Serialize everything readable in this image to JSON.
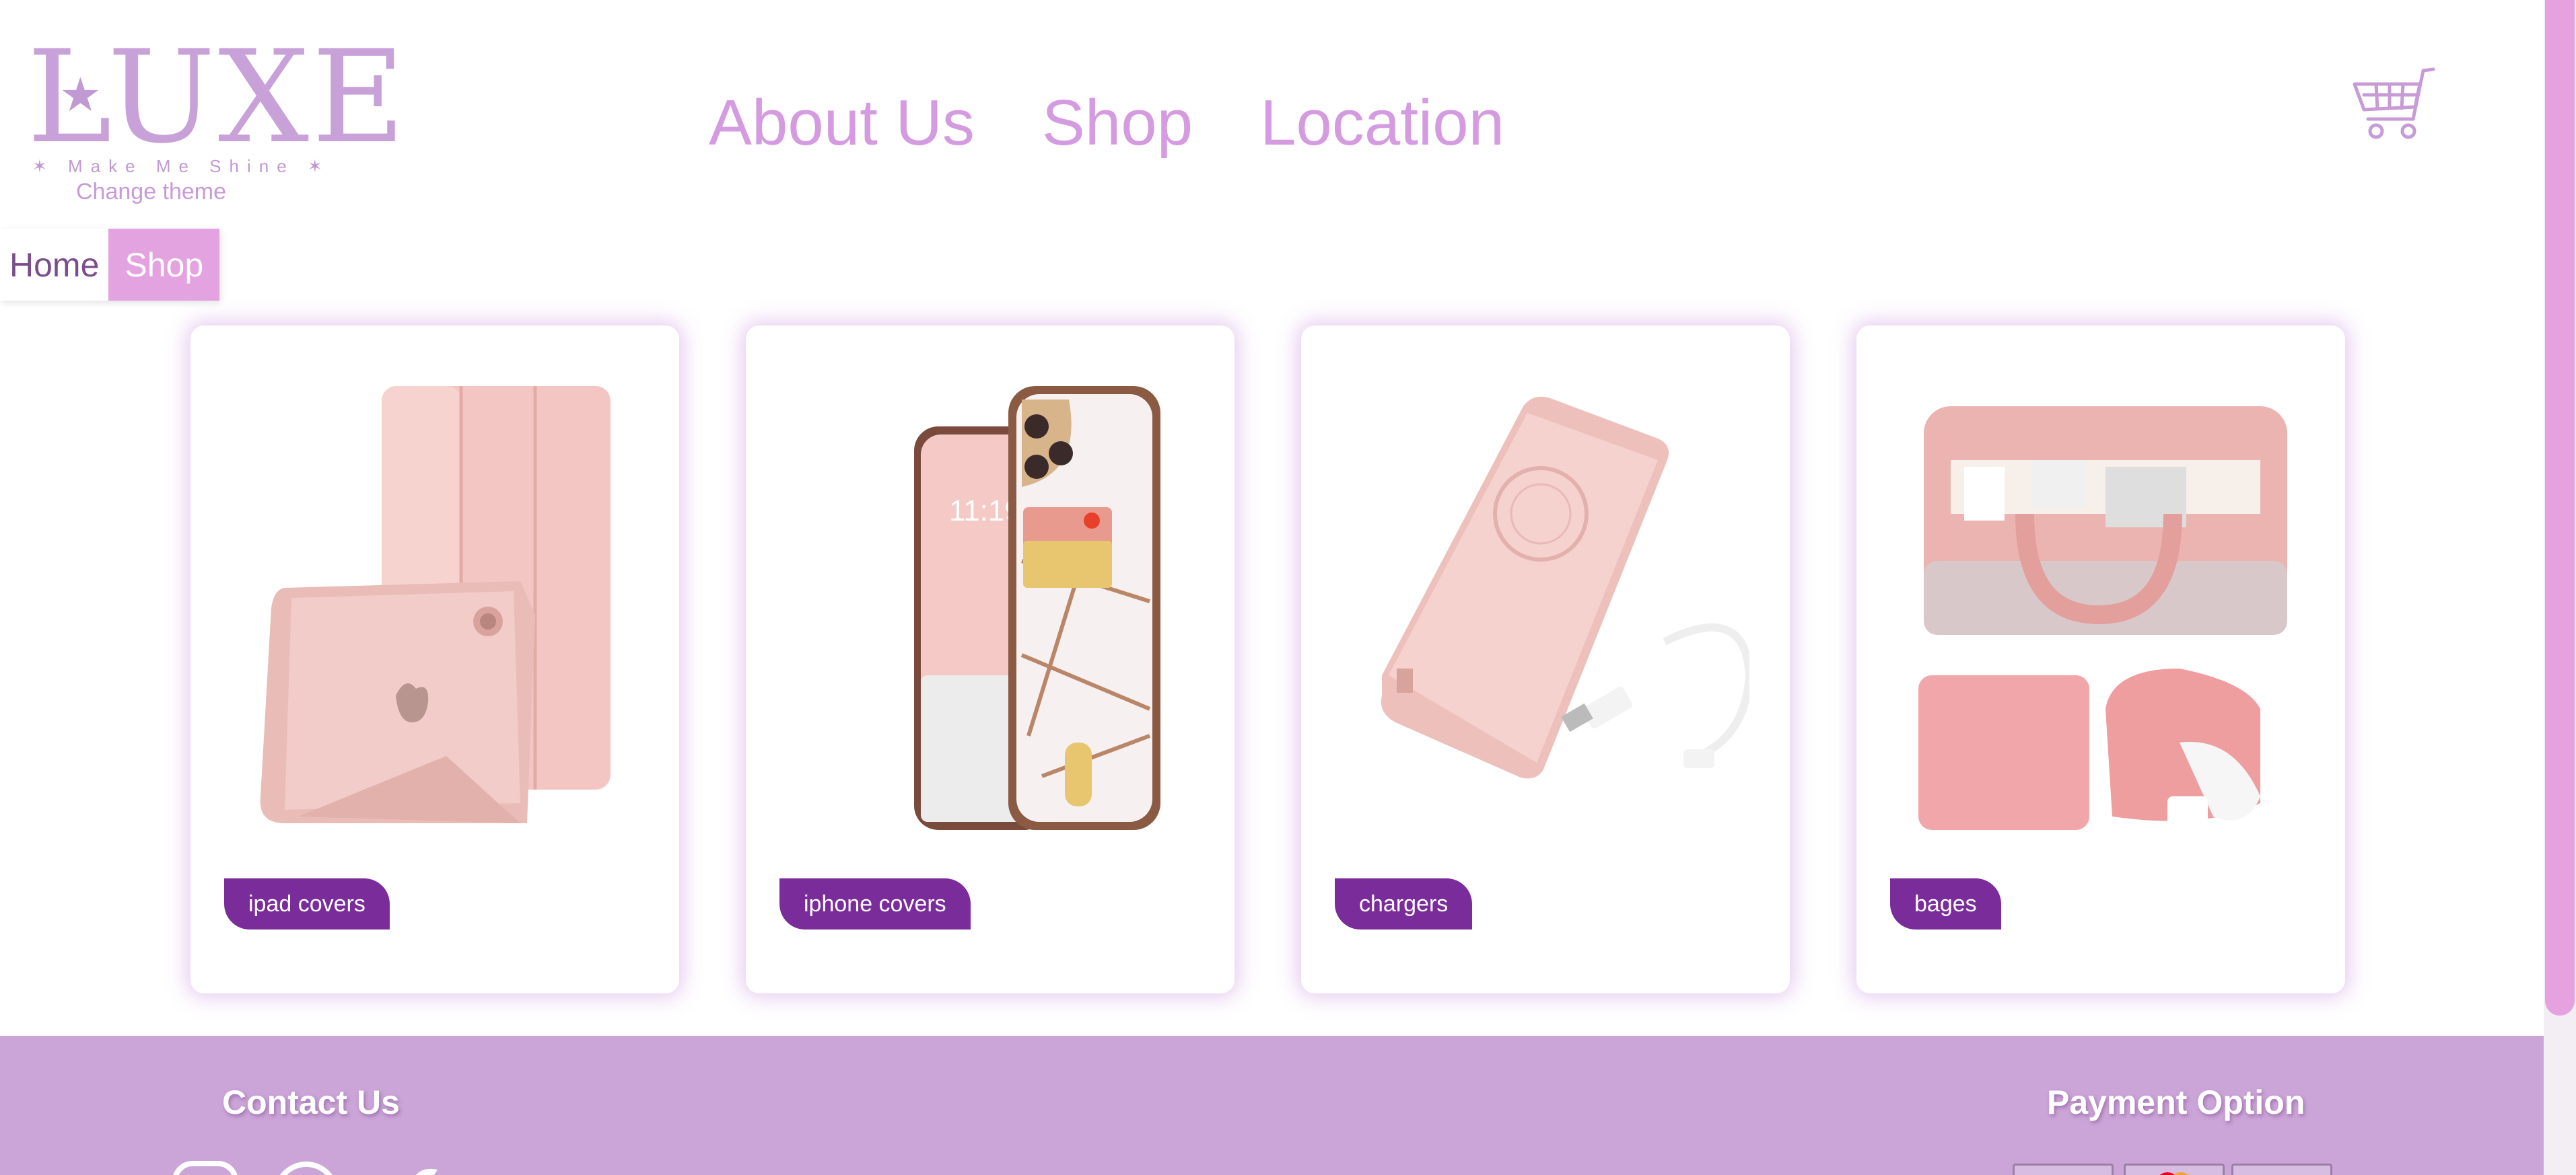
{
  "brand": {
    "logo_text": "LUXE",
    "tagline": "Make Me Shine",
    "change_theme": "Change theme"
  },
  "nav": {
    "items": [
      "About Us",
      "Shop",
      "Location"
    ]
  },
  "breadcrumb": {
    "items": [
      "Home",
      "Shop"
    ],
    "active": "Shop"
  },
  "products": [
    {
      "label": "ipad covers",
      "image": "pink-ipad-case-image"
    },
    {
      "label": "iphone covers",
      "image": "pink-marble-iphone-case-image"
    },
    {
      "label": "chargers",
      "image": "pink-power-bank-image"
    },
    {
      "label": "bages",
      "image": "pink-laptop-bag-set-image"
    }
  ],
  "footer": {
    "contact_title": "Contact Us",
    "payment_title": "Payment Option"
  },
  "colors": {
    "accent": "#d49be0",
    "tag": "#7a2d9a",
    "footer": "#cba5d7",
    "scroll_thumb": "#e5a2df"
  },
  "icons": [
    "cart-icon",
    "instagram-icon",
    "facebook-icon",
    "twitter-icon"
  ]
}
